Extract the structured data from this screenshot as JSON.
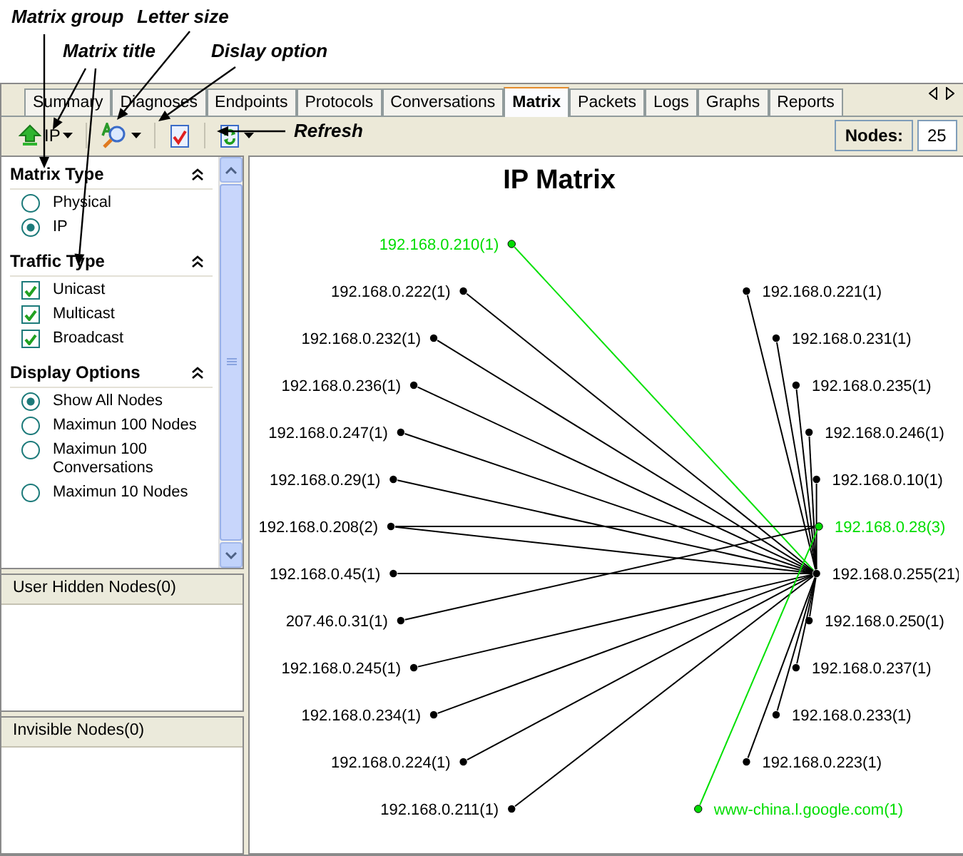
{
  "annotations": [
    {
      "text": "Matrix group"
    },
    {
      "text": "Letter size"
    },
    {
      "text": "Matrix title"
    },
    {
      "text": "Dislay option"
    },
    {
      "text": "Refresh"
    }
  ],
  "tabs": [
    {
      "label": "Summary",
      "selected": false
    },
    {
      "label": "Diagnoses",
      "selected": false
    },
    {
      "label": "Endpoints",
      "selected": false
    },
    {
      "label": "Protocols",
      "selected": false
    },
    {
      "label": "Conversations",
      "selected": false
    },
    {
      "label": "Matrix",
      "selected": true
    },
    {
      "label": "Packets",
      "selected": false
    },
    {
      "label": "Logs",
      "selected": false
    },
    {
      "label": "Graphs",
      "selected": false
    },
    {
      "label": "Reports",
      "selected": false
    }
  ],
  "toolbar": {
    "group": "IP",
    "nodes_label": "Nodes:",
    "nodes_value": "25"
  },
  "sidebar": {
    "sections": [
      {
        "title": "Matrix Type",
        "items": [
          {
            "kind": "radio",
            "label": "Physical",
            "selected": false
          },
          {
            "kind": "radio",
            "label": "IP",
            "selected": true
          }
        ]
      },
      {
        "title": "Traffic Type",
        "items": [
          {
            "kind": "checkbox",
            "label": "Unicast",
            "checked": true
          },
          {
            "kind": "checkbox",
            "label": "Multicast",
            "checked": true
          },
          {
            "kind": "checkbox",
            "label": "Broadcast",
            "checked": true
          }
        ]
      },
      {
        "title": "Display Options",
        "items": [
          {
            "kind": "radio",
            "label": "Show All Nodes",
            "selected": true
          },
          {
            "kind": "radio",
            "label": "Maximun 100 Nodes",
            "selected": false
          },
          {
            "kind": "radio",
            "label": "Maximun 100 Conversations",
            "selected": false
          },
          {
            "kind": "radio",
            "label": "Maximun 10 Nodes",
            "selected": false
          }
        ]
      }
    ]
  },
  "lists": [
    {
      "title": "User Hidden Nodes(0)"
    },
    {
      "title": "Invisible Nodes(0)"
    }
  ],
  "matrix": {
    "title": "IP Matrix",
    "left_nodes": [
      {
        "label": "192.168.0.210(1)",
        "highlighted": true,
        "kind": "spoke"
      },
      {
        "label": "192.168.0.222(1)",
        "highlighted": false,
        "kind": "spoke"
      },
      {
        "label": "192.168.0.232(1)",
        "highlighted": false,
        "kind": "spoke"
      },
      {
        "label": "192.168.0.236(1)",
        "highlighted": false,
        "kind": "spoke"
      },
      {
        "label": "192.168.0.247(1)",
        "highlighted": false,
        "kind": "spoke"
      },
      {
        "label": "192.168.0.29(1)",
        "highlighted": false,
        "kind": "spoke"
      },
      {
        "label": "192.168.0.208(2)",
        "highlighted": false,
        "kind": "dual"
      },
      {
        "label": "192.168.0.45(1)",
        "highlighted": false,
        "kind": "spoke"
      },
      {
        "label": "207.46.0.31(1)",
        "highlighted": false,
        "kind": "outer"
      },
      {
        "label": "192.168.0.245(1)",
        "highlighted": false,
        "kind": "spoke"
      },
      {
        "label": "192.168.0.234(1)",
        "highlighted": false,
        "kind": "spoke"
      },
      {
        "label": "192.168.0.224(1)",
        "highlighted": false,
        "kind": "spoke"
      },
      {
        "label": "192.168.0.211(1)",
        "highlighted": false,
        "kind": "spoke"
      }
    ],
    "right_nodes": [
      {
        "label": "192.168.0.221(1)",
        "highlighted": false,
        "kind": "spoke"
      },
      {
        "label": "192.168.0.231(1)",
        "highlighted": false,
        "kind": "spoke"
      },
      {
        "label": "192.168.0.235(1)",
        "highlighted": false,
        "kind": "spoke"
      },
      {
        "label": "192.168.0.246(1)",
        "highlighted": false,
        "kind": "spoke"
      },
      {
        "label": "192.168.0.10(1)",
        "highlighted": false,
        "kind": "spoke"
      },
      {
        "label": "192.168.0.28(3)",
        "highlighted": true,
        "kind": "relay"
      },
      {
        "label": "192.168.0.255(21)",
        "highlighted": false,
        "kind": "hub"
      },
      {
        "label": "192.168.0.250(1)",
        "highlighted": false,
        "kind": "spoke"
      },
      {
        "label": "192.168.0.237(1)",
        "highlighted": false,
        "kind": "spoke"
      },
      {
        "label": "192.168.0.233(1)",
        "highlighted": false,
        "kind": "spoke"
      },
      {
        "label": "192.168.0.223(1)",
        "highlighted": false,
        "kind": "spoke"
      },
      {
        "label": "www-china.l.google.com(1)",
        "highlighted": true,
        "kind": "outer"
      }
    ]
  }
}
